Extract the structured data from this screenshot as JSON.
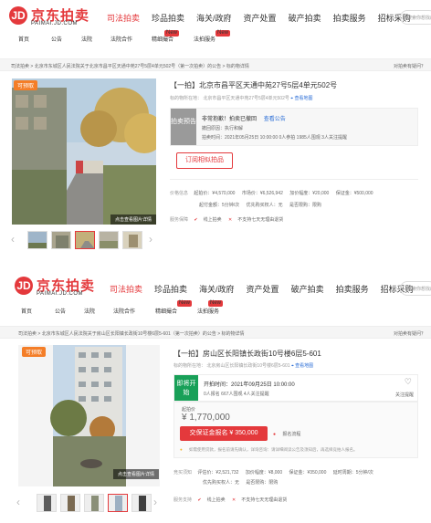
{
  "header": {
    "logo_cn": "京东拍卖",
    "logo_en": "PAIMAI.JD.COM",
    "logo_mark": "JD",
    "nav": [
      "司法拍卖",
      "珍品拍卖",
      "海关/政府",
      "资产处置",
      "破产拍卖",
      "拍卖服务",
      "招标采购"
    ],
    "search_placeholder": "搜索你想找的"
  },
  "subnav": {
    "items": [
      "首页",
      "公告",
      "法院",
      "法院合作",
      "精细撮合",
      "法拍服务"
    ],
    "new_badge": "New"
  },
  "s1": {
    "breadcrumb": "司法拍卖 > 北京市东城区人民法院关于北京市昌平区天通中苑27号5层4单元502号（第一次拍卖）的公告 > 标的物详情",
    "breadcrumb_right": "对拍卖有疑问？",
    "status": "可预取",
    "title": "【一拍】北京市昌平区天通中苑27号5层4单元502号",
    "address_label": "标的物所在地：",
    "address": "北京市昌平区天通中苑27号5层4单元502号",
    "map_link": "查看地图",
    "stage": "拍卖预告",
    "panel_line1": "非常抱歉！拍卖已撤回",
    "panel_link": "查看公告",
    "panel_line2": "撤回原因：执行和解",
    "panel_line3": "拍卖时间：2021年05月25日 10:00:00  0人参拍  1985人围观  3人关注提醒",
    "action_button": "订阅相似拍品",
    "price_label": "价格信息",
    "prices": [
      "起拍价：¥4,570,000",
      "市场价：¥6,526,942",
      "加价幅度：¥20,000",
      "保证金：¥500,000"
    ],
    "prices2": [
      "起付金额：5分钟/次",
      "优先购买权人：无",
      "是否限购：限购"
    ],
    "service_label": "服务保障",
    "services": [
      "线上拍卖",
      "不支持七天无理由退货"
    ],
    "photo_button": "点击查看图片详情"
  },
  "s2": {
    "breadcrumb": "司法拍卖 > 北京市东城区人民法院关于房山区长阳镇长政街10号楼6层5-601（第一次拍卖）的公告 > 标的物详情",
    "breadcrumb_right": "对拍卖有疑问？",
    "status": "可预取",
    "title": "【一拍】房山区长阳镇长政街10号楼6层5-601",
    "address_label": "标的物所在地：",
    "address": "北京房山区长阳镇长政街10号楼6层5-601",
    "map_link": "查看地图",
    "stage": "即将开始",
    "start_label": "开拍时间：2021年09月25日 10:00:00",
    "watch_line": "0人报名  667人围观  4人关注提醒",
    "follow_label": "关注提醒",
    "price_label": "起拍价",
    "price": "¥ 1,770,000",
    "register_button": "交保证金报名 ¥ 350,000",
    "process_link": "报名流程",
    "notice": "如需使用贷款，报名前请先确认，详询咨询：请详细阅读公告及须知后，再选择竞拍人报名。",
    "price_info_label": "竞买须知",
    "prices": [
      "评估价：¥2,521,732",
      "加价幅度：¥8,000",
      "保证金：¥350,000",
      "延时周期：5分钟/次"
    ],
    "prices2": [
      "优先购买权人：无",
      "是否限购：限购"
    ],
    "service_label": "服务支持",
    "services": [
      "线上拍卖",
      "不支持七天无理由退货"
    ],
    "photo_button": "点击查看图片详情"
  },
  "colors": {
    "brand": "#e4393c",
    "badge": "#f47e28",
    "stage_grey": "#9a9a9a",
    "stage_green": "#18a058"
  }
}
